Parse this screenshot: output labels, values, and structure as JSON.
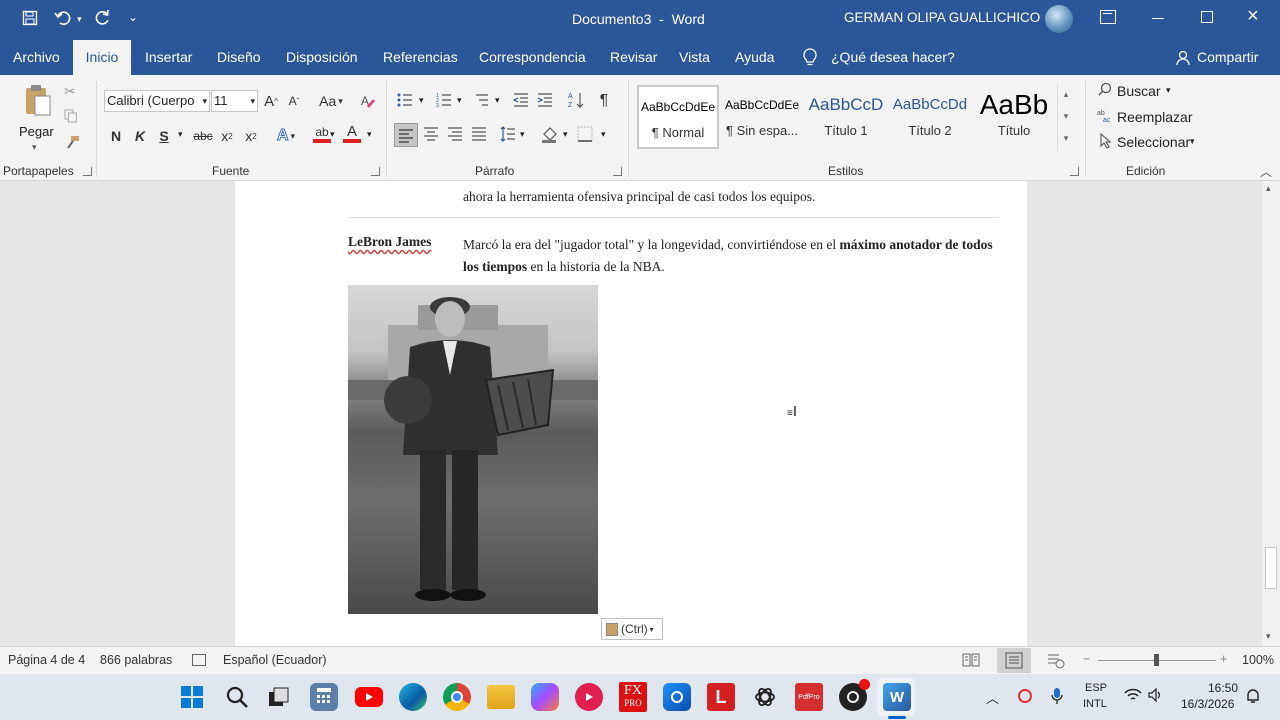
{
  "titlebar": {
    "doc_title": "Documento3  -  Word",
    "user": "GERMAN OLIPA GUALLICHICO",
    "qat_more": "⌄"
  },
  "tabs": [
    {
      "label": "Archivo",
      "active": false
    },
    {
      "label": "Inicio",
      "active": true
    },
    {
      "label": "Insertar",
      "active": false
    },
    {
      "label": "Diseño",
      "active": false
    },
    {
      "label": "Disposición",
      "active": false
    },
    {
      "label": "Referencias",
      "active": false
    },
    {
      "label": "Correspondencia",
      "active": false
    },
    {
      "label": "Revisar",
      "active": false
    },
    {
      "label": "Vista",
      "active": false
    },
    {
      "label": "Ayuda",
      "active": false
    }
  ],
  "tell_me": "¿Qué desea hacer?",
  "share": "Compartir",
  "ribbon": {
    "clipboard": {
      "paste": "Pegar",
      "group": "Portapapeles"
    },
    "font": {
      "name": "Calibri (Cuerpo",
      "size": "11",
      "grow": "A",
      "shrink": "A",
      "case": "Aa",
      "bold": "N",
      "italic": "K",
      "underline": "S",
      "strike": "abc",
      "subscript": "x",
      "superscript": "x",
      "sub_mark": "2",
      "effects": "A",
      "highlight": "ab",
      "color": "A",
      "group": "Fuente"
    },
    "paragraph": {
      "pilcrow": "¶",
      "group": "Párrafo"
    },
    "styles": {
      "items": [
        {
          "preview": "AaBbCcDdEe",
          "name": "¶ Normal"
        },
        {
          "preview": "AaBbCcDdEe",
          "name": "¶ Sin espa..."
        },
        {
          "preview": "AaBbCcD",
          "name": "Título 1"
        },
        {
          "preview": "AaBbCcDd",
          "name": "Título 2"
        },
        {
          "preview": "AaBb",
          "name": "Título"
        }
      ],
      "group": "Estilos"
    },
    "editing": {
      "find": "Buscar",
      "replace": "Reemplazar",
      "select": "Seleccionar",
      "group": "Edición"
    }
  },
  "document": {
    "row_prev_text": "ahora la herramienta ofensiva principal de casi todos los equipos.",
    "row_name": "LeBron James",
    "row_text_before": "Marcó la era del \"jugador total\" y la longevidad, convirtiéndose en el ",
    "row_text_bold": "máximo anotador de todos los tiempos",
    "row_text_after": " en la historia de la NBA.",
    "paste_options": "(Ctrl)"
  },
  "statusbar": {
    "page": "Página 4 de 4",
    "words": "866 palabras",
    "language": "Español (Ecuador)",
    "zoom_minus": "−",
    "zoom_plus": "+",
    "zoom": "100%"
  },
  "taskbar": {
    "lang": "ESP",
    "layout": "INTL",
    "time": "16:50",
    "date": "16/3/2026",
    "fx_label": "FX",
    "fx_sub": "PRO",
    "l_label": "L",
    "pdf_label": "PdfPro",
    "word_label": "W"
  },
  "colors": {
    "brand": "#2b579a",
    "ribbon_bg": "#f3f3f3",
    "doc_bg": "#e6e6e6",
    "font_color_bar": "#e02020",
    "highlight_bar": "#ffff00"
  }
}
